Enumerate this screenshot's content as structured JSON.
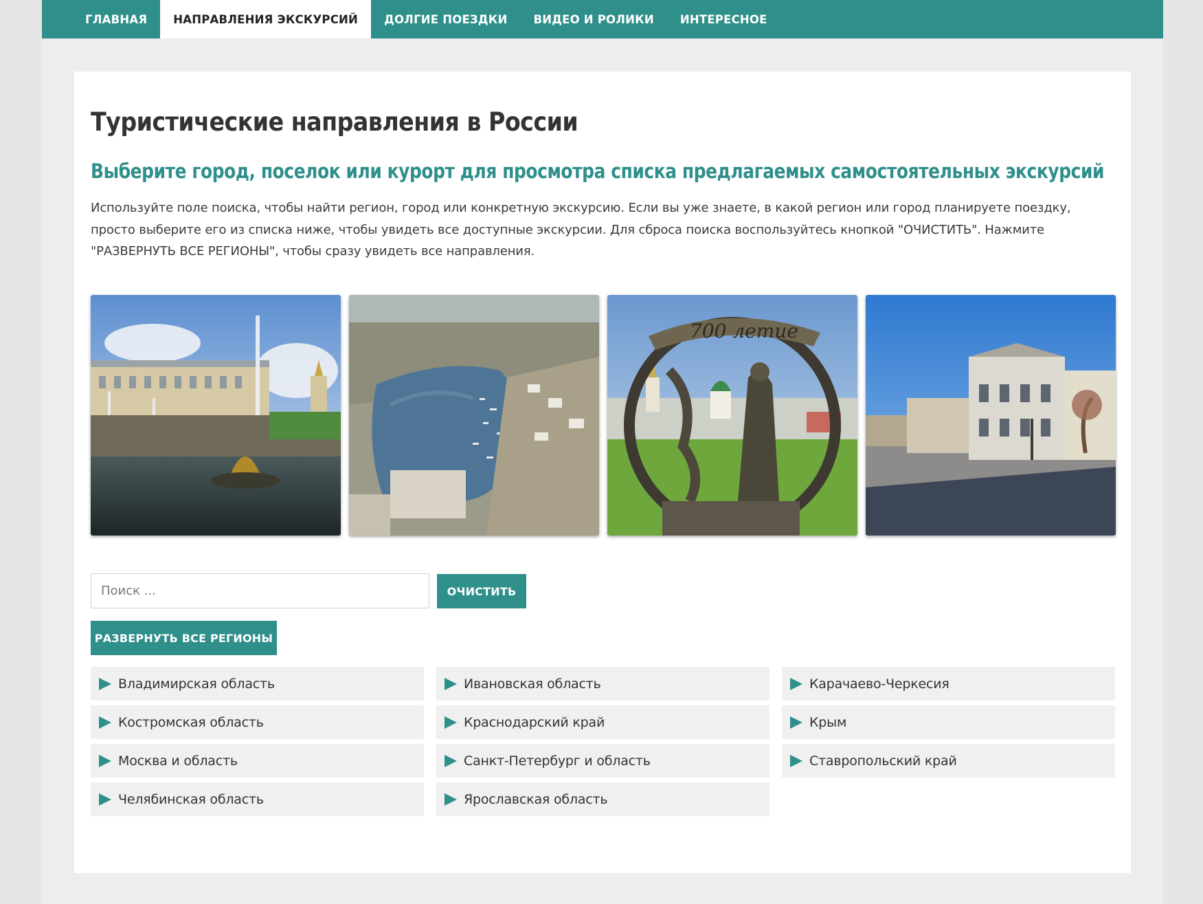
{
  "nav": {
    "items": [
      {
        "label": "ГЛАВНАЯ",
        "active": false
      },
      {
        "label": "НАПРАВЛЕНИЯ ЭКСКУРСИЙ",
        "active": true
      },
      {
        "label": "ДОЛГИЕ ПОЕЗДКИ",
        "active": false
      },
      {
        "label": "ВИДЕО И РОЛИКИ",
        "active": false
      },
      {
        "label": "ИНТЕРЕСНОЕ",
        "active": false
      }
    ]
  },
  "page": {
    "title": "Туристические направления в России",
    "subtitle": "Выберите город, поселок или курорт для просмотра списка предлагаемых самостоятельных экскурсий",
    "intro": "Используйте поле поиска, чтобы найти регион, город или конкретную экскурсию. Если вы уже знаете, в какой регион или город планируете поездку, просто выберите его из списка ниже, чтобы увидеть все доступные экскурсии. Для сброса поиска воспользуйтесь кнопкой \"ОЧИСТИТЬ\". Нажмите \"РАЗВЕРНУТЬ ВСЕ РЕГИОНЫ\", чтобы сразу увидеть все направления."
  },
  "gallery": {
    "photo_1_text": "",
    "photo_3_text": "700 летие"
  },
  "search": {
    "placeholder": "Поиск ...",
    "value": "",
    "clear_label": "ОЧИСТИТЬ",
    "expand_label": "РАЗВЕРНУТЬ ВСЕ РЕГИОНЫ"
  },
  "regions": {
    "items": [
      "Владимирская область",
      "Ивановская область",
      "Карачаево-Черкесия",
      "Костромская область",
      "Краснодарский край",
      "Крым",
      "Москва и область",
      "Санкт-Петербург и область",
      "Ставропольский край",
      "Челябинская область",
      "Ярославская область"
    ]
  },
  "colors": {
    "accent": "#2e8f8b",
    "page_bg": "#ededed",
    "region_bg": "#f0f0f0"
  }
}
